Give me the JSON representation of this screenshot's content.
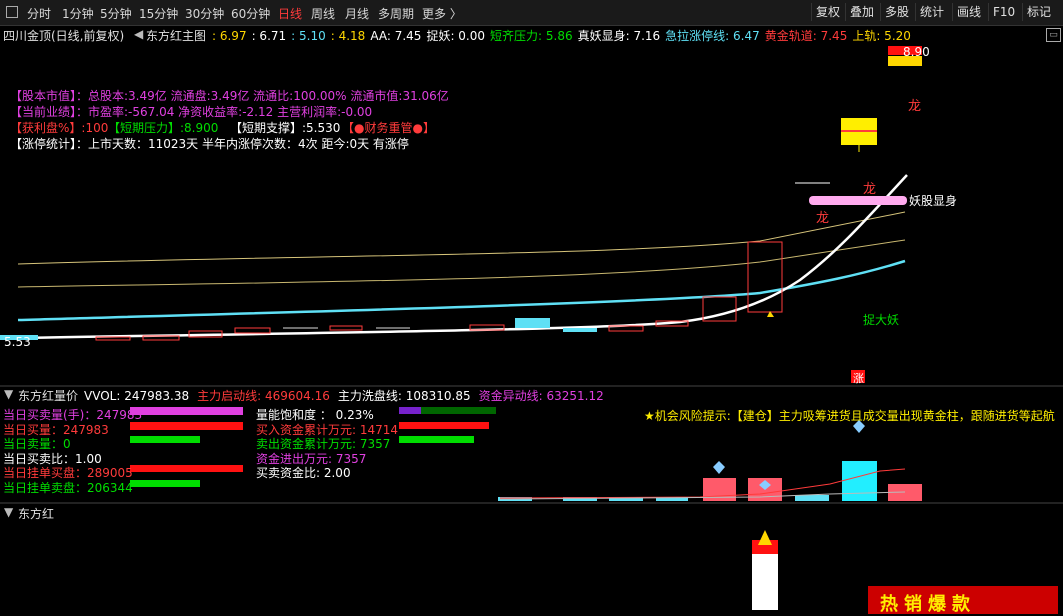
{
  "toolbar": {
    "tabs": [
      "分时",
      "1分钟",
      "5分钟",
      "15分钟",
      "30分钟",
      "60分钟",
      "日线",
      "周线",
      "月线",
      "多周期",
      "更多 〉"
    ],
    "active_tab": "日线",
    "right_buttons": [
      "复权",
      "叠加",
      "多股",
      "统计",
      "画线",
      "F10",
      "标记"
    ]
  },
  "main": {
    "stock_label": "四川金顶(日线,前复权)",
    "indicator_name": "东方红主图",
    "values": [
      {
        "text": ": 6.97",
        "color": "#ffd700"
      },
      {
        "text": ": 6.71",
        "color": "#ffffff"
      },
      {
        "text": ": 5.10",
        "color": "#5fe0f5"
      },
      {
        "text": ": 4.18",
        "color": "#ffd700"
      },
      {
        "text": "AA: 7.45",
        "color": "#ffffff"
      },
      {
        "text": "捉妖: 0.00",
        "color": "#ffffff"
      },
      {
        "text": "短齐压力: 5.86",
        "color": "#00dd00"
      },
      {
        "text": "真妖显身: 7.16",
        "color": "#ffffff"
      },
      {
        "text": "急拉涨停线: 6.47",
        "color": "#5fe0f5"
      },
      {
        "text": "黄金轨道: 7.45",
        "color": "#ff3b3b"
      },
      {
        "text": "上轨: 5.20",
        "color": "#ffd700"
      }
    ],
    "fundamentals": {
      "line1": "【股本市值】：总股本:3.49亿 流通盘:3.49亿 流通比:100.00% 流通市值:31.06亿",
      "line2": "【当前业绩】：市盈率:-567.04 净资收益率:-2.12 主营利润率:-0.00",
      "line3a": "【获利盘%】:100",
      "line3b": "【短期压力】:8.900",
      "line3c": "【短期支撑】:5.530",
      "line3d": "【●财务重管●】",
      "line4": "【涨停统计】：上市天数：11023天 半年内涨停次数：4次  距今:0天 有涨停"
    },
    "price_high": "8.90",
    "price_low": "5.53",
    "labels": {
      "dragon1": "龙",
      "dragon2": "龙",
      "dragon3": "龙",
      "yaogu": "妖股显身",
      "zhuoyao": "捉大妖",
      "zhang": "涨"
    }
  },
  "volume_panel": {
    "title": "东方红量价",
    "values": [
      {
        "text": "VVOL: 247983.38",
        "color": "#ffffff"
      },
      {
        "text": "主力启动线: 469604.16",
        "color": "#ff3b3b"
      },
      {
        "text": "主力洗盘线: 108310.85",
        "color": "#ffffff"
      },
      {
        "text": "资金异动线: 63251.12",
        "color": "#e040e0"
      }
    ],
    "left_stats": [
      {
        "text": "当日买卖量(手)：247983",
        "color": "#e040e0"
      },
      {
        "text": "当日买量：247983",
        "color": "#ff3b3b"
      },
      {
        "text": "当日卖量：0",
        "color": "#00dd00"
      },
      {
        "text": "当日买卖比：1.00",
        "color": "#ffffff"
      },
      {
        "text": "当日挂单买盘：289005",
        "color": "#ff3b3b"
      },
      {
        "text": "当日挂单卖盘：206344",
        "color": "#00dd00"
      }
    ],
    "mid_stats": [
      {
        "text": "量能饱和度 ： 0.23%",
        "color": "#ffffff"
      },
      {
        "text": "买入资金累计万元: 14714",
        "color": "#ff3b3b"
      },
      {
        "text": "卖出资金累计万元: 7357",
        "color": "#00dd00"
      },
      {
        "text": "资金进出万元: 7357",
        "color": "#e040e0"
      },
      {
        "text": "买卖资金比: 2.00",
        "color": "#ffffff"
      }
    ],
    "tip": "★机会风险提示:【建仓】主力吸筹进货且成交量出现黄金柱，跟随进货等起航"
  },
  "bottom_panel": {
    "title": "东方红",
    "ad_text": "热销爆款"
  },
  "colors": {
    "up": "#ff3b3b",
    "down": "#00dd00",
    "cyan": "#5fe0f5",
    "magenta": "#e040e0",
    "yellow": "#ffd700"
  }
}
